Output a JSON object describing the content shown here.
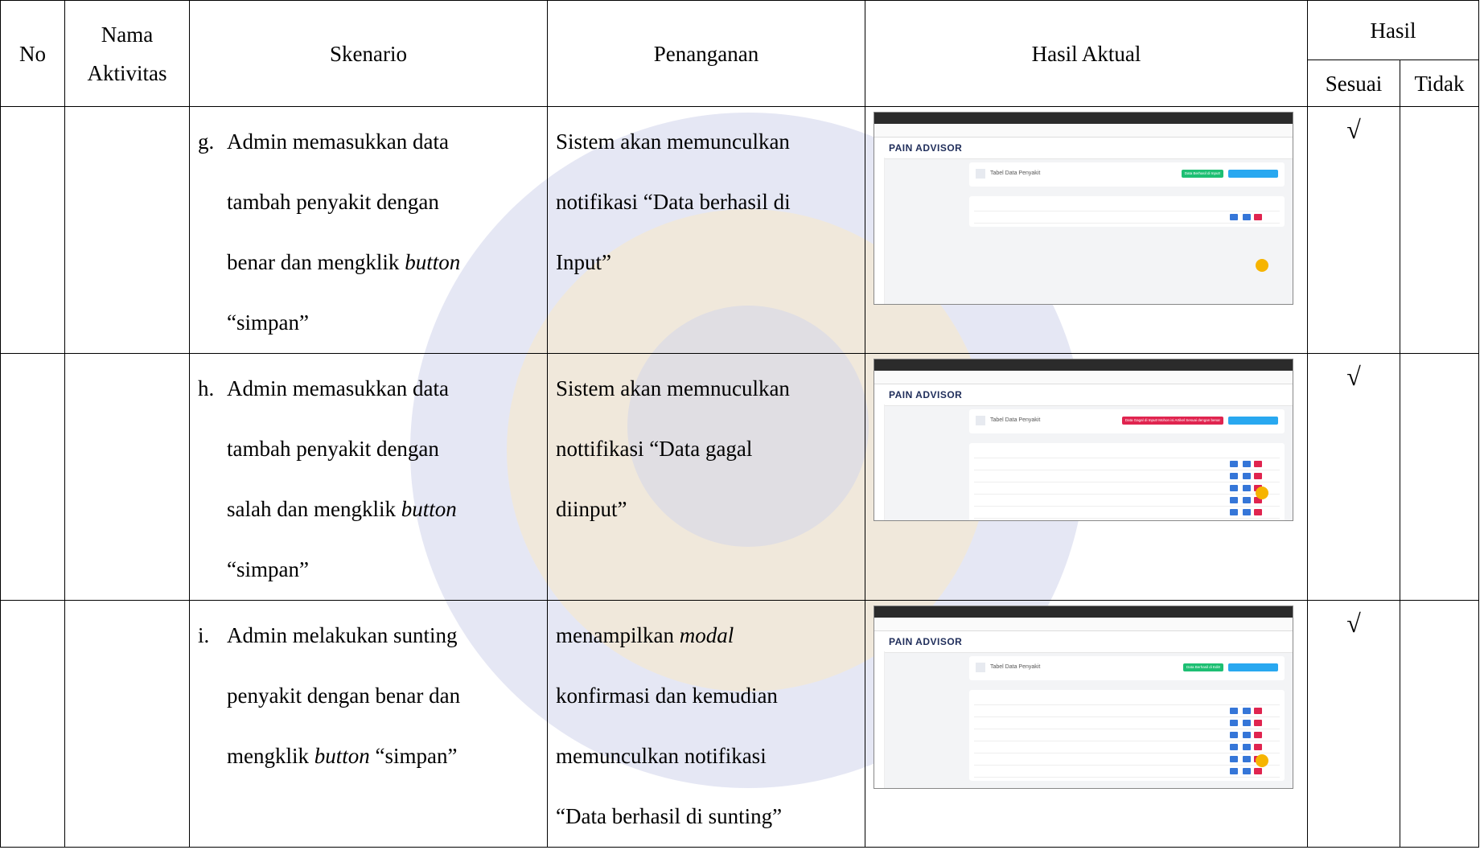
{
  "headers": {
    "no": "No",
    "nama_aktivitas_1": "Nama",
    "nama_aktivitas_2": "Aktivitas",
    "skenario": "Skenario",
    "penanganan": "Penanganan",
    "hasil_aktual": "Hasil Aktual",
    "hasil": "Hasil",
    "sesuai": "Sesuai",
    "tidak": "Tidak"
  },
  "rows": [
    {
      "letter": "g.",
      "skenario": [
        "Admin memasukkan data",
        "tambah penyakit dengan",
        "benar dan mengklik ",
        "“simpan”"
      ],
      "skenario_italic": "button",
      "penanganan": [
        "Sistem akan memunculkan",
        "notifikasi “Data berhasil di",
        "Input”"
      ],
      "sesuai": "√",
      "screenshot": {
        "logo": "PAIN ADVISOR",
        "page_title": "Tabel Data Penyakit",
        "alert": "Data Berhasil di Input!"
      }
    },
    {
      "letter": "h.",
      "skenario": [
        "Admin memasukkan data",
        "tambah penyakit dengan",
        "salah dan mengklik ",
        "“simpan”"
      ],
      "skenario_italic": "button",
      "penanganan": [
        "Sistem akan memnuculkan",
        "nottifikasi “Data gagal",
        "diinput”"
      ],
      "sesuai": "√",
      "screenshot": {
        "logo": "PAIN ADVISOR",
        "page_title": "Tabel Data Penyakit",
        "alert": "Data Gagal di Input! Mohon isi Artikel Sesuai dengan benar"
      }
    },
    {
      "letter": "i.",
      "skenario": [
        "Admin melakukan sunting",
        "penyakit dengan benar dan",
        "mengklik ",
        " “simpan”"
      ],
      "skenario_italic": "button",
      "penanganan_a": "menampilkan ",
      "penanganan_italic": "modal",
      "penanganan": [
        "konfirmasi dan kemudian",
        "memunculkan notifikasi",
        "“Data berhasil di sunting”"
      ],
      "sesuai": "√",
      "screenshot": {
        "logo": "PAIN ADVISOR",
        "page_title": "Tabel Data Penyakit",
        "alert": "Data Berhasil di Edit!"
      }
    }
  ],
  "colors": {
    "success": "#1dbf73",
    "danger": "#e0244f",
    "primary": "#29a8f0",
    "watermark_blue": "#5a63b8",
    "watermark_gold": "#e7b23a"
  }
}
